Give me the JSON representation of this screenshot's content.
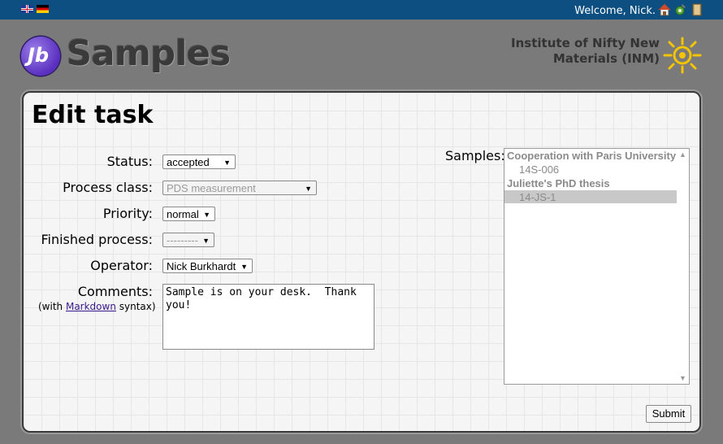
{
  "topbar": {
    "welcome": "Welcome, Nick.",
    "languages": [
      "en",
      "de"
    ],
    "icons": [
      "home-icon",
      "preferences-icon",
      "logout-icon"
    ]
  },
  "header": {
    "logo_mark": "Jb",
    "logo_text": "Samples",
    "institute_line1": "Institute of Nifty New",
    "institute_line2": "Materials (INM)"
  },
  "form": {
    "title": "Edit task",
    "status": {
      "label": "Status:",
      "value": "accepted"
    },
    "process_class": {
      "label": "Process class:",
      "value": "PDS measurement",
      "disabled": true
    },
    "priority": {
      "label": "Priority:",
      "value": "normal"
    },
    "finished_process": {
      "label": "Finished process:",
      "value": "---------",
      "disabled": true
    },
    "operator": {
      "label": "Operator:",
      "value": "Nick Burkhardt"
    },
    "comments": {
      "label": "Comments:",
      "hint_prefix": "(with ",
      "hint_link": "Markdown",
      "hint_suffix": " syntax)",
      "value": "Sample is on your desk.  Thank\nyou!"
    },
    "samples": {
      "label": "Samples:",
      "groups": [
        {
          "name": "Cooperation with Paris University",
          "items": [
            "14S-006"
          ]
        },
        {
          "name": "Juliette's PhD thesis",
          "items": [
            "14-JS-1"
          ]
        }
      ],
      "selected": "14-JS-1"
    },
    "submit_label": "Submit"
  },
  "colors": {
    "topbar": "#0d4f80",
    "background": "#7a7a7a",
    "logo": "#6a40d0",
    "sun": "#f5c400"
  }
}
